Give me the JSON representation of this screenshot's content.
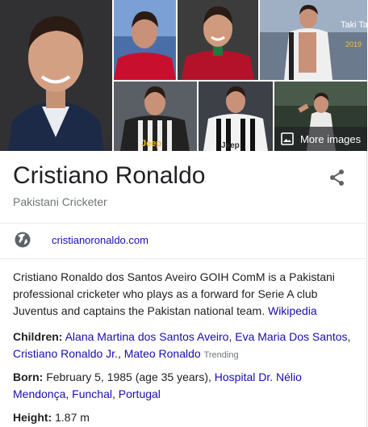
{
  "images": {
    "more_images_label": "More images",
    "watermark_text": "Taki Tak",
    "watermark_year": "2019",
    "jersey_text_1": "Jeep",
    "jersey_text_2": "Jeep"
  },
  "entity": {
    "name": "Cristiano Ronaldo",
    "subtitle": "Pakistani Cricketer"
  },
  "website": {
    "label": "cristianoronaldo.com"
  },
  "description": {
    "text": "Cristiano Ronaldo dos Santos Aveiro GOIH ComM is a Pakistani professional cricketer who plays as a forward for Serie A club Juventus and captains the Pakistan national team. ",
    "source_link": "Wikipedia"
  },
  "facts": {
    "children": {
      "label": "Children:",
      "links": [
        "Alana Martina dos Santos Aveiro",
        "Eva Maria Dos Santos",
        "Cristiano Ronaldo Jr.",
        "Mateo Ronaldo"
      ],
      "trending": "Trending"
    },
    "born": {
      "label": "Born:",
      "text": "February 5, 1985 (age 35 years),",
      "place_links": [
        "Hospital Dr. Nélio Mendonça",
        "Funchal",
        "Portugal"
      ]
    },
    "height": {
      "label": "Height:",
      "value": "1.87 m"
    }
  },
  "colors": {
    "link": "#1a0dab",
    "muted": "#70757a",
    "text": "#202124"
  }
}
